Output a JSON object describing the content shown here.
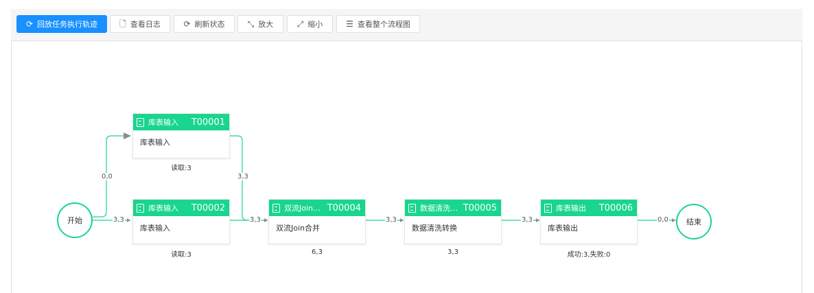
{
  "toolbar": {
    "replay_label": "回放任务执行轨迹",
    "log_label": "查看日志",
    "refresh_label": "刷新状态",
    "zoom_in_label": "放大",
    "zoom_out_label": "缩小",
    "view_all_label": "查看整个流程图"
  },
  "flow": {
    "start_label": "开始",
    "end_label": "结束",
    "nodes": [
      {
        "title": "库表输入",
        "code": "T00001",
        "body": "库表输入",
        "stat": "读取:3"
      },
      {
        "title": "库表输入",
        "code": "T00002",
        "body": "库表输入",
        "stat": "读取:3"
      },
      {
        "title": "双流Join合并",
        "code": "T00004",
        "body": "双流Join合并",
        "stat": "6,3"
      },
      {
        "title": "数据清洗转...",
        "code": "T00005",
        "body": "数据清洗转换",
        "stat": "3,3"
      },
      {
        "title": "库表输出",
        "code": "T00006",
        "body": "库表输出",
        "stat": "成功:3,失败:0"
      }
    ],
    "edges": [
      {
        "label": "0,0"
      },
      {
        "label": "3,3"
      },
      {
        "label": "3,3"
      },
      {
        "label": "3,3"
      },
      {
        "label": "3,3"
      },
      {
        "label": "3,3"
      },
      {
        "label": "0,0"
      }
    ]
  },
  "colors": {
    "primary": "#1890ff",
    "node_header": "#19d58e",
    "circle_border": "#19d58e",
    "edge": "#19d58e"
  }
}
